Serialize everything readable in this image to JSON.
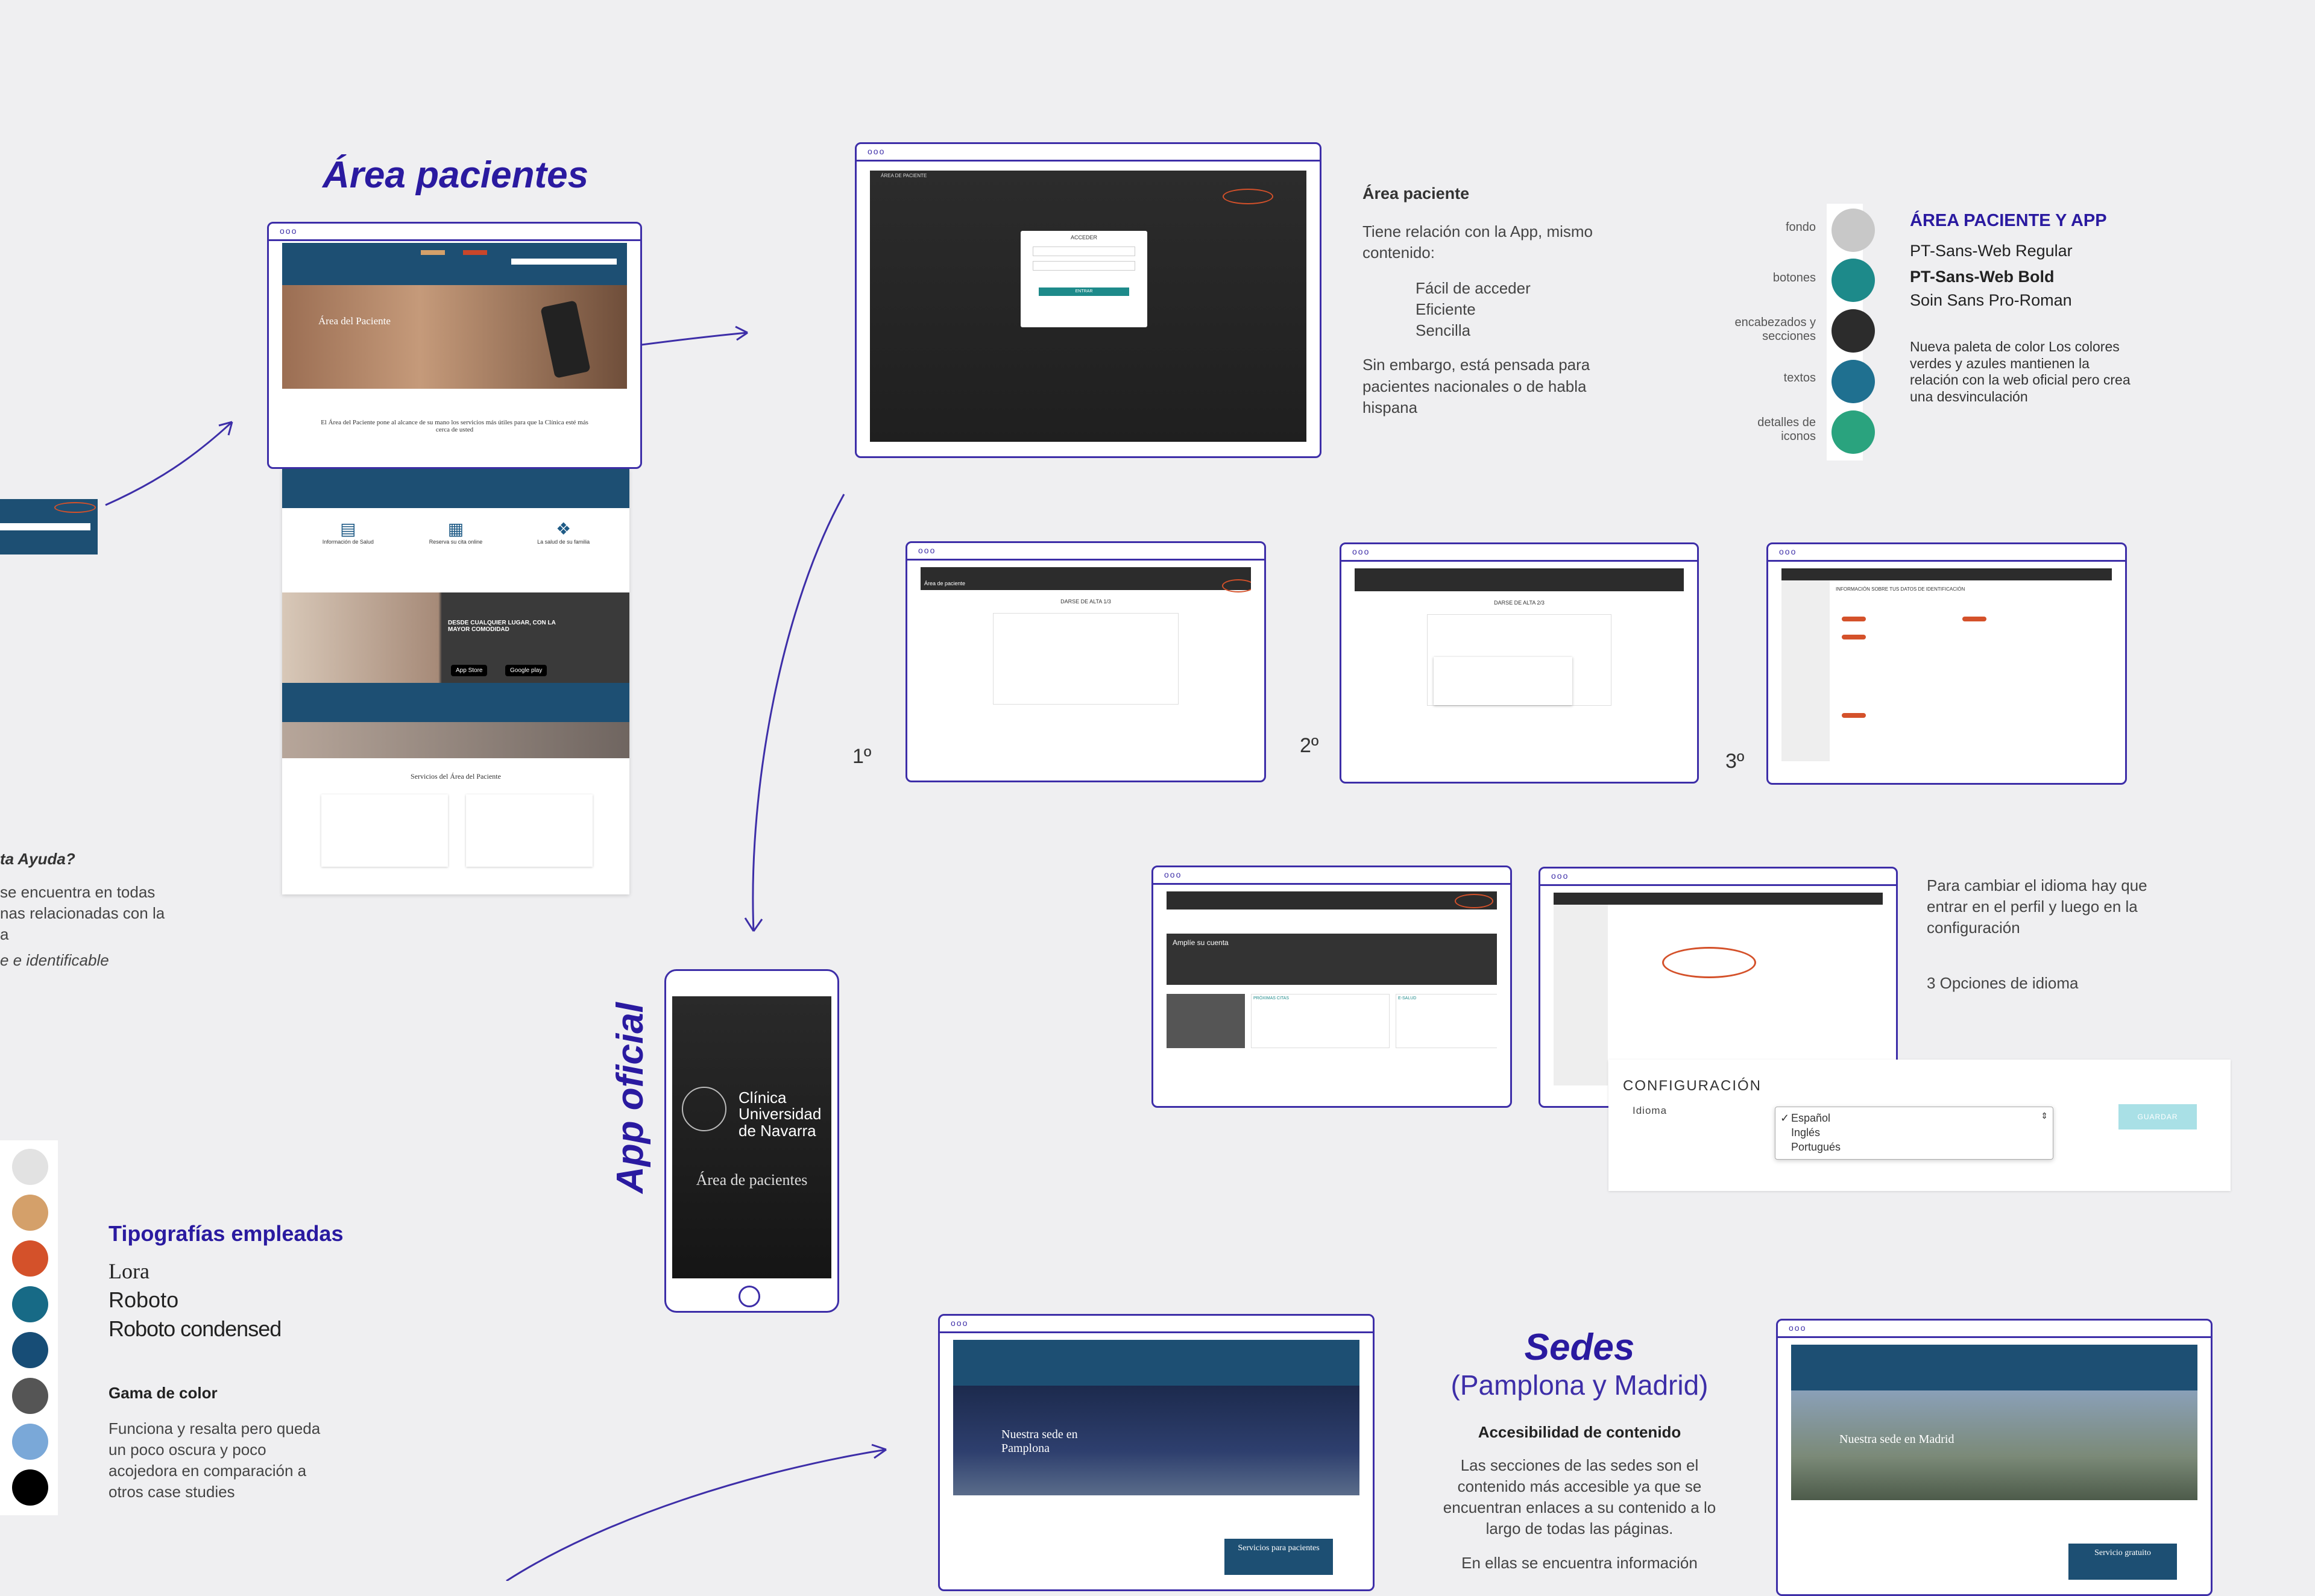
{
  "area_pacientes": {
    "title": "Área pacientes",
    "hero_title": "Área del Paciente",
    "intro": "El Área del Paciente pone al alcance de su mano los servicios más útiles para que la Clínica esté más cerca de usted",
    "features": [
      "Información de Salud",
      "Reserva su cita online",
      "La salud de su familia"
    ],
    "banner": "DESDE CUALQUIER LUGAR, CON LA MAYOR COMODIDAD",
    "app_store": "App Store",
    "google_play": "Google play",
    "services_title": "Servicios del Área del Paciente"
  },
  "ayuda_fragment": {
    "heading": "ta Ayuda?",
    "line1": "se encuentra en todas",
    "line2": "nas relacionadas con la",
    "line3": "a",
    "line4": "e e identificable"
  },
  "login_screen": {
    "header": "ÁREA DE PACIENTE",
    "panel_title": "ACCEDER",
    "button": "ENTRAR"
  },
  "area_paciente_notes": {
    "title": "Área paciente",
    "p1": "Tiene relación con la App, mismo contenido:",
    "bullets": [
      "Fácil de acceder",
      "Eficiente",
      "Sencilla"
    ],
    "p2": "Sin embargo, está pensada para pacientes nacionales o de habla hispana"
  },
  "palette_app": {
    "title": "ÁREA PACIENTE Y APP",
    "labels": [
      "fondo",
      "botones",
      "encabezados y secciones",
      "textos",
      "detalles de iconos"
    ],
    "colors": [
      "#c8c8c8",
      "#1d8a8a",
      "#2c2c2c",
      "#1f7090",
      "#2aa37e"
    ],
    "fonts": [
      "PT-Sans-Web Regular",
      "PT-Sans-Web Bold",
      "Soin Sans Pro-Roman"
    ],
    "note": "Nueva paleta de color Los colores verdes y azules mantienen la relación con la web oficial pero crea una desvinculación"
  },
  "steps": {
    "labels": [
      "1º",
      "2º",
      "3º"
    ],
    "titles": [
      "DARSE DE ALTA 1/3",
      "DARSE DE ALTA 2/3",
      "INFORMACIÓN SOBRE TUS DATOS DE IDENTIFICACIÓN"
    ],
    "header": "Área de paciente"
  },
  "profile": {
    "banner": "Amplíe su cuenta",
    "panels": [
      "PRÓXIMAS CITAS",
      "E-SALUD"
    ]
  },
  "idioma": {
    "note1": "Para cambiar el idioma hay que entrar en el perfil y luego en la configuración",
    "note2": "3 Opciones de idioma",
    "config_title": "CONFIGURACIÓN",
    "label": "Idioma",
    "options": [
      "Español",
      "Inglés",
      "Portugués"
    ],
    "save": "GUARDAR"
  },
  "app_oficial": {
    "title": "App oficial",
    "brand_line1": "Clínica",
    "brand_line2": "Universidad",
    "brand_line3": "de Navarra",
    "subtitle": "Área de pacientes"
  },
  "left_palette": {
    "colors": [
      "#e2e2e2",
      "#d4a06a",
      "#d4512a",
      "#176a86",
      "#174d76",
      "#555555",
      "#7aa8d8",
      "#000000"
    ]
  },
  "typography": {
    "title": "Tipografías empleadas",
    "fonts": [
      "Lora",
      "Roboto",
      "Roboto condensed"
    ],
    "gama_title": "Gama de color",
    "gama_text": "Funciona y resalta pero queda un poco oscura y poco acojedora en comparación a otros case studies"
  },
  "sedes": {
    "title": "Sedes",
    "subtitle": "(Pamplona y Madrid)",
    "access_title": "Accesibilidad de contenido",
    "access_text": "Las secciones de las sedes son el contenido más accesible ya que se encuentran enlaces a su contenido a lo largo de todas las páginas.",
    "access_cut": "En ellas se encuentra información",
    "pamplona_hero": "Nuestra sede en Pamplona",
    "madrid_hero": "Nuestra sede en Madrid",
    "pamplona_btn": "Servicios para pacientes",
    "madrid_btn": "Servicio gratuito"
  }
}
